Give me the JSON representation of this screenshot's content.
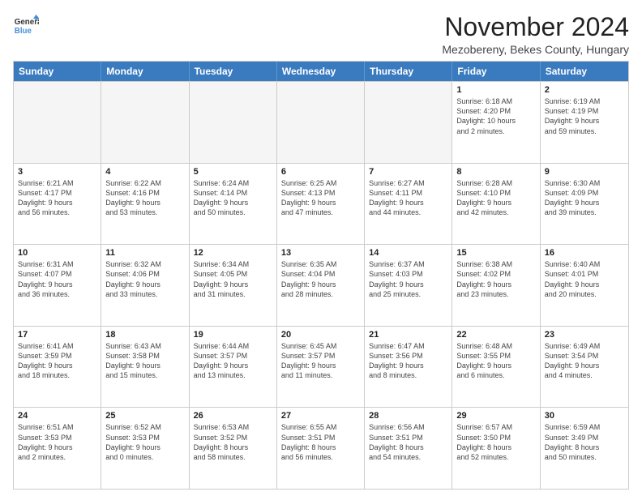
{
  "logo": {
    "line1": "General",
    "line2": "Blue"
  },
  "title": "November 2024",
  "location": "Mezobereny, Bekes County, Hungary",
  "header_days": [
    "Sunday",
    "Monday",
    "Tuesday",
    "Wednesday",
    "Thursday",
    "Friday",
    "Saturday"
  ],
  "rows": [
    [
      {
        "day": "",
        "info": "",
        "empty": true
      },
      {
        "day": "",
        "info": "",
        "empty": true
      },
      {
        "day": "",
        "info": "",
        "empty": true
      },
      {
        "day": "",
        "info": "",
        "empty": true
      },
      {
        "day": "",
        "info": "",
        "empty": true
      },
      {
        "day": "1",
        "info": "Sunrise: 6:18 AM\nSunset: 4:20 PM\nDaylight: 10 hours\nand 2 minutes.",
        "empty": false
      },
      {
        "day": "2",
        "info": "Sunrise: 6:19 AM\nSunset: 4:19 PM\nDaylight: 9 hours\nand 59 minutes.",
        "empty": false
      }
    ],
    [
      {
        "day": "3",
        "info": "Sunrise: 6:21 AM\nSunset: 4:17 PM\nDaylight: 9 hours\nand 56 minutes.",
        "empty": false
      },
      {
        "day": "4",
        "info": "Sunrise: 6:22 AM\nSunset: 4:16 PM\nDaylight: 9 hours\nand 53 minutes.",
        "empty": false
      },
      {
        "day": "5",
        "info": "Sunrise: 6:24 AM\nSunset: 4:14 PM\nDaylight: 9 hours\nand 50 minutes.",
        "empty": false
      },
      {
        "day": "6",
        "info": "Sunrise: 6:25 AM\nSunset: 4:13 PM\nDaylight: 9 hours\nand 47 minutes.",
        "empty": false
      },
      {
        "day": "7",
        "info": "Sunrise: 6:27 AM\nSunset: 4:11 PM\nDaylight: 9 hours\nand 44 minutes.",
        "empty": false
      },
      {
        "day": "8",
        "info": "Sunrise: 6:28 AM\nSunset: 4:10 PM\nDaylight: 9 hours\nand 42 minutes.",
        "empty": false
      },
      {
        "day": "9",
        "info": "Sunrise: 6:30 AM\nSunset: 4:09 PM\nDaylight: 9 hours\nand 39 minutes.",
        "empty": false
      }
    ],
    [
      {
        "day": "10",
        "info": "Sunrise: 6:31 AM\nSunset: 4:07 PM\nDaylight: 9 hours\nand 36 minutes.",
        "empty": false
      },
      {
        "day": "11",
        "info": "Sunrise: 6:32 AM\nSunset: 4:06 PM\nDaylight: 9 hours\nand 33 minutes.",
        "empty": false
      },
      {
        "day": "12",
        "info": "Sunrise: 6:34 AM\nSunset: 4:05 PM\nDaylight: 9 hours\nand 31 minutes.",
        "empty": false
      },
      {
        "day": "13",
        "info": "Sunrise: 6:35 AM\nSunset: 4:04 PM\nDaylight: 9 hours\nand 28 minutes.",
        "empty": false
      },
      {
        "day": "14",
        "info": "Sunrise: 6:37 AM\nSunset: 4:03 PM\nDaylight: 9 hours\nand 25 minutes.",
        "empty": false
      },
      {
        "day": "15",
        "info": "Sunrise: 6:38 AM\nSunset: 4:02 PM\nDaylight: 9 hours\nand 23 minutes.",
        "empty": false
      },
      {
        "day": "16",
        "info": "Sunrise: 6:40 AM\nSunset: 4:01 PM\nDaylight: 9 hours\nand 20 minutes.",
        "empty": false
      }
    ],
    [
      {
        "day": "17",
        "info": "Sunrise: 6:41 AM\nSunset: 3:59 PM\nDaylight: 9 hours\nand 18 minutes.",
        "empty": false
      },
      {
        "day": "18",
        "info": "Sunrise: 6:43 AM\nSunset: 3:58 PM\nDaylight: 9 hours\nand 15 minutes.",
        "empty": false
      },
      {
        "day": "19",
        "info": "Sunrise: 6:44 AM\nSunset: 3:57 PM\nDaylight: 9 hours\nand 13 minutes.",
        "empty": false
      },
      {
        "day": "20",
        "info": "Sunrise: 6:45 AM\nSunset: 3:57 PM\nDaylight: 9 hours\nand 11 minutes.",
        "empty": false
      },
      {
        "day": "21",
        "info": "Sunrise: 6:47 AM\nSunset: 3:56 PM\nDaylight: 9 hours\nand 8 minutes.",
        "empty": false
      },
      {
        "day": "22",
        "info": "Sunrise: 6:48 AM\nSunset: 3:55 PM\nDaylight: 9 hours\nand 6 minutes.",
        "empty": false
      },
      {
        "day": "23",
        "info": "Sunrise: 6:49 AM\nSunset: 3:54 PM\nDaylight: 9 hours\nand 4 minutes.",
        "empty": false
      }
    ],
    [
      {
        "day": "24",
        "info": "Sunrise: 6:51 AM\nSunset: 3:53 PM\nDaylight: 9 hours\nand 2 minutes.",
        "empty": false
      },
      {
        "day": "25",
        "info": "Sunrise: 6:52 AM\nSunset: 3:53 PM\nDaylight: 9 hours\nand 0 minutes.",
        "empty": false
      },
      {
        "day": "26",
        "info": "Sunrise: 6:53 AM\nSunset: 3:52 PM\nDaylight: 8 hours\nand 58 minutes.",
        "empty": false
      },
      {
        "day": "27",
        "info": "Sunrise: 6:55 AM\nSunset: 3:51 PM\nDaylight: 8 hours\nand 56 minutes.",
        "empty": false
      },
      {
        "day": "28",
        "info": "Sunrise: 6:56 AM\nSunset: 3:51 PM\nDaylight: 8 hours\nand 54 minutes.",
        "empty": false
      },
      {
        "day": "29",
        "info": "Sunrise: 6:57 AM\nSunset: 3:50 PM\nDaylight: 8 hours\nand 52 minutes.",
        "empty": false
      },
      {
        "day": "30",
        "info": "Sunrise: 6:59 AM\nSunset: 3:49 PM\nDaylight: 8 hours\nand 50 minutes.",
        "empty": false
      }
    ]
  ]
}
